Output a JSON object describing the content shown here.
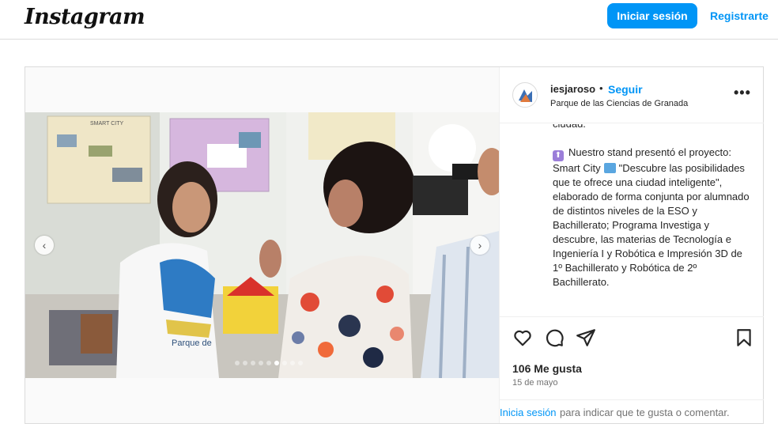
{
  "header": {
    "logo": "Instagram",
    "login_button": "Iniciar sesión",
    "register_link": "Registrarte"
  },
  "post": {
    "username": "iesjaroso",
    "separator": "•",
    "follow": "Seguir",
    "location": "Parque de las Ciencias de Granada",
    "more_icon": "more-horizontal-icon",
    "caption": {
      "line_partial": "ciudad.",
      "paragraph": "Nuestro stand presentó el proyecto: Smart City",
      "paragraph_rest": "\"Descubre las posibilidades que te ofrece una ciudad inteligente\", elaborado de forma conjunta por alumnado de distintos niveles de la ESO y Bachillerato; Programa Investiga y descubre, las materias de Tecnología e Ingeniería I y Robótica e Impresión 3D de 1º Bachillerato y Robótica de 2º Bachillerato."
    },
    "likes": "106 Me gusta",
    "date": "15 de mayo",
    "footer_login": "Inicia sesión",
    "footer_rest": "para indicar que te gusta o comentar.",
    "carousel": {
      "count": 9,
      "active_index": 5
    },
    "photo_poster_label": "SMART CITY",
    "photo_shirt_text": "Parque de",
    "accent_color": "#0095f6"
  }
}
